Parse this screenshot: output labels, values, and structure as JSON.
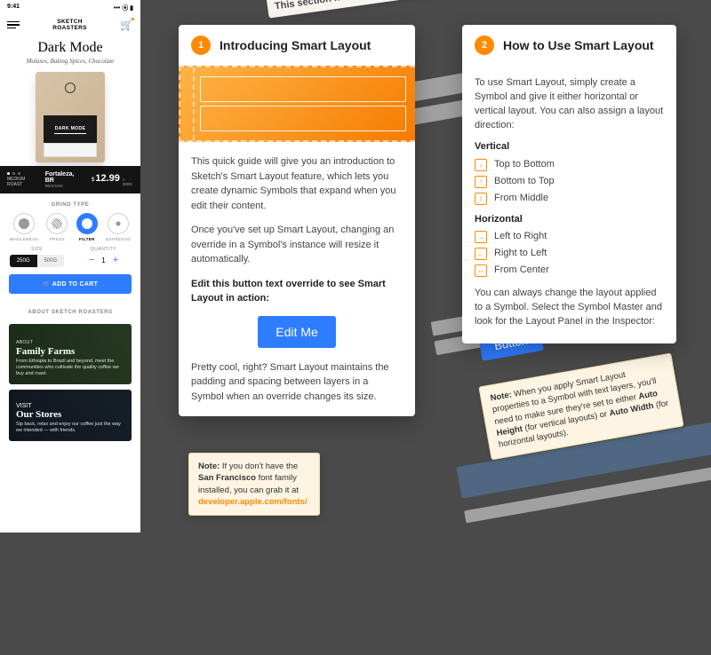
{
  "phone": {
    "time": "9:41",
    "brand_l1": "SKETCH",
    "brand_l2": "ROASTERS",
    "title": "Dark Mode",
    "subtitle": "Molases, Baking Spices, Chocolate",
    "bag_label": "DARK MODE",
    "roast": "MEDIUM ROAST",
    "region": "Fortaleza, BR",
    "region_sub": "REGION",
    "price_symbol": "$",
    "price": "12.99",
    "unit": "× 250G",
    "grind_header": "GRIND TYPE",
    "grinds": [
      "WHOLEBEAN",
      "PRESS",
      "FILTER",
      "ESPRESSO"
    ],
    "size_label": "SIZE",
    "size_a": "250G",
    "size_b": "500G",
    "qty_label": "QUANTITY",
    "qty": "1",
    "add_cart": "🛒 ADD TO CART",
    "about_header": "ABOUT SKETCH ROASTERS",
    "farm_tag": "ABOUT",
    "farm_title": "Family Farms",
    "farm_desc": "From Ethiopia to Brazil and beyond, meet the communities who cultivate the quality coffee we buy and roast.",
    "stores_tag": "VISIT",
    "stores_title": "Our Stores",
    "stores_desc": "Sip back, relax and enjoy our coffee just the way we intended — with friends."
  },
  "card1": {
    "num": "1",
    "title": "Introducing Smart Layout",
    "p1": "This quick guide will give you an introduction to Sketch's Smart Layout feature, which lets you create dynamic Symbols that expand when you edit their content.",
    "p2": "Once you've set up Smart Layout, changing an override in a Symbol's instance will resize it automatically.",
    "p3": "Edit this button text override to see Smart Layout in action:",
    "button": "Edit Me",
    "p4": "Pretty cool, right? Smart Layout maintains the padding and spacing between layers in a Symbol when an override changes its size."
  },
  "note1": {
    "bold": "Note:",
    "text": " If you don't have the ",
    "font": "San Francisco",
    "text2": " font family installed, you can grab it at ",
    "link": "developer.apple.com/fonts/"
  },
  "card2": {
    "num": "2",
    "title": "How to Use Smart Layout",
    "intro": "To use Smart Layout, simply create a Symbol and give it either horizontal or vertical layout. You can also assign a layout direction:",
    "v_head": "Vertical",
    "v_opts": [
      "Top to Bottom",
      "Bottom to Top",
      "From Middle"
    ],
    "h_head": "Horizontal",
    "h_opts": [
      "Left to Right",
      "Right to Left",
      "From Center"
    ],
    "outro": "You can always change the layout applied to a Symbol. Select the Symbol Master and look for the Layout Panel in the Inspector:"
  },
  "bg": {
    "button": "Button",
    "note_bold": "Note:",
    "note_text": " When you apply Smart Layout properties to a Symbol with text layers, you'll need to make sure they're set to either ",
    "ah": "Auto Height",
    "mid": " (for vertical layouts) or ",
    "aw": "Auto Width",
    "end": " (for horizontal layouts).",
    "hdr_text": "This section has Horizontal Layout applied"
  }
}
